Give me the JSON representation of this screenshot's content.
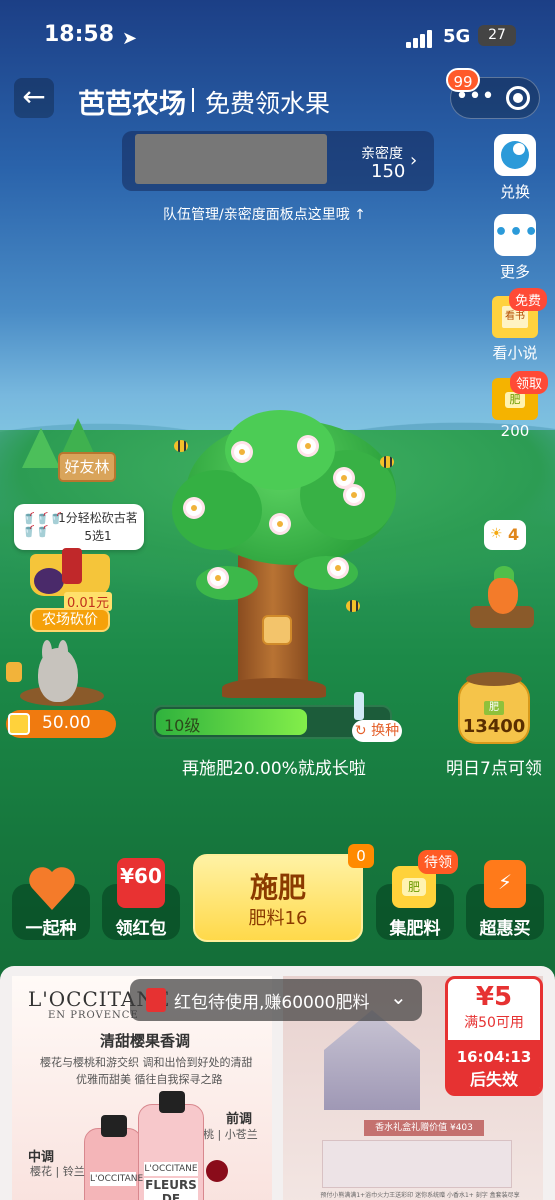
{
  "status": {
    "time": "18:58",
    "network": "5G",
    "battery": "27"
  },
  "header": {
    "title": "芭芭农场",
    "subtitle": "免费领水果",
    "badge": "99",
    "more": "•••"
  },
  "team": {
    "intimacy_label": "亲密度",
    "intimacy_value": "150",
    "hint": "队伍管理/亲密度面板点这里哦 ↑"
  },
  "right_menu": {
    "exchange": "兑换",
    "more": "更多",
    "more_dots": "•••",
    "novel": "看小说",
    "novel_tag": "免费",
    "novel_icon": "看书",
    "fert_tag": "领取",
    "fert_icon": "肥",
    "fert_value": "200"
  },
  "left": {
    "friends": "好友林",
    "bubble": "1分轻松砍古茗5选1",
    "price": "0.01元",
    "chop": "农场砍价",
    "coins": "50.00"
  },
  "tree": {
    "level": "10级",
    "swap": "换种",
    "progress_fraction": 0.65,
    "grow_text": "再施肥20.00%就成长啦"
  },
  "right_side": {
    "sun_count": "4",
    "sun_icon": "☀",
    "sack_label": "肥",
    "sack_value": "13400",
    "tomorrow": "明日7点可领"
  },
  "actions": {
    "plant_together": "一起种",
    "red_packet": "领红包",
    "red_packet_value": "¥60",
    "fertilize": "施肥",
    "fertilizer_count": "肥料16",
    "fertilize_badge": "0",
    "collect": "集肥料",
    "collect_tag": "待领",
    "collect_icon": "肥",
    "super_deal": "超惠买",
    "super_deal_icon": "⚡"
  },
  "product": {
    "brand": "L'OCCITANE",
    "province": "EN PROVENCE",
    "title": "清甜樱果香调",
    "line1": "樱花与樱桃和游交织 调和出恰到好处的清甜",
    "line2": "优雅而甜美 循往自我探寻之路",
    "top_note": "前调",
    "top_note_detail": "樱桃 | 小苍兰",
    "mid_note": "中调",
    "mid_note_detail": "樱花 | 铃兰",
    "bottle_label1": "L'OCCITANE",
    "bottle_label2": "L'OCCITANE",
    "bottle_name": "FLEURS DE CERISIER",
    "gift_band": "香水礼盒礼赠价值 ¥403",
    "gift_text": "预付小熊满满1+浴巾火力王送彩印 迷你系统赠 小香水1+ 刻字 盒套装尽享",
    "notice": "红包待使用,赚60000肥料",
    "coupon_value": "¥5",
    "coupon_cond": "满50可用",
    "coupon_time": "16:04:13",
    "coupon_expire": "后失效"
  }
}
